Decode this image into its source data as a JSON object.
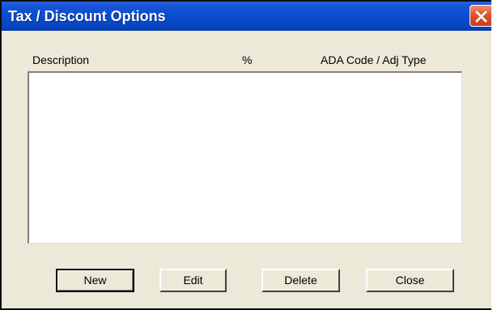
{
  "window": {
    "title": "Tax / Discount Options",
    "close_icon": "close-x-icon"
  },
  "list": {
    "columns": [
      "Description",
      "%",
      "ADA Code / Adj Type"
    ],
    "rows": []
  },
  "buttons": {
    "new": "New",
    "edit": "Edit",
    "delete": "Delete",
    "close": "Close"
  },
  "colors": {
    "titlebar": "#0a4fd3",
    "dialog_bg": "#ece9d8",
    "close_button": "#e0542e"
  }
}
